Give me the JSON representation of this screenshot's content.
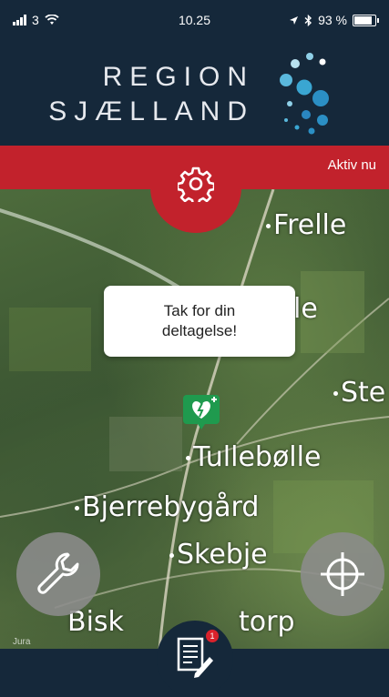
{
  "status_bar": {
    "carrier": "3",
    "time": "10.25",
    "battery_percent": "93 %",
    "battery_level": 0.93
  },
  "header": {
    "logo_line1": "REGION",
    "logo_line2": "SJÆLLAND"
  },
  "banner": {
    "status_text": "Aktiv nu",
    "settings_icon": "gear-icon"
  },
  "popup": {
    "line1": "Tak for din",
    "line2": "deltagelse!"
  },
  "map": {
    "places": [
      "Frelle",
      "le",
      "Ste",
      "Tullebølle",
      "Bjerrebygård",
      "Skebje",
      "Bisk",
      "torp"
    ],
    "corner_label": "Jura",
    "marker_icon": "heart-defibrillator-icon"
  },
  "buttons": {
    "tools_icon": "wrench-icon",
    "locate_icon": "crosshair-icon",
    "report_icon": "document-pen-icon",
    "report_badge": "1"
  },
  "colors": {
    "navy": "#15283a",
    "red": "#c2222c",
    "marker_green": "#1f9a4e"
  }
}
